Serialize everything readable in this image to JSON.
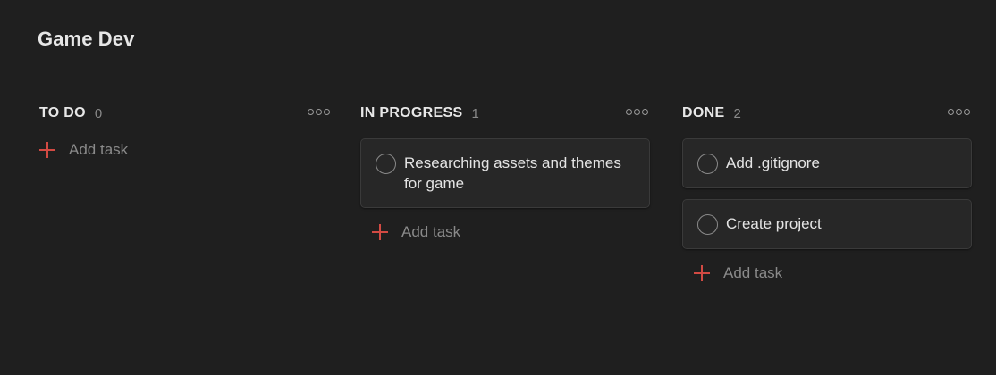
{
  "board": {
    "title": "Game Dev"
  },
  "columns": {
    "todo": {
      "name": "TO DO",
      "count": "0",
      "add_label": "Add task"
    },
    "in_progress": {
      "name": "IN PROGRESS",
      "count": "1",
      "add_label": "Add task",
      "tasks": [
        {
          "title": "Researching assets and themes for game"
        }
      ]
    },
    "done": {
      "name": "DONE",
      "count": "2",
      "add_label": "Add task",
      "tasks": [
        {
          "title": "Add .gitignore"
        },
        {
          "title": "Create project"
        }
      ]
    }
  },
  "icons": {
    "column_menu": "more-horizontal-icon",
    "add": "plus-icon",
    "task_check": "circle-check-icon"
  },
  "colors": {
    "background": "#1f1f1f",
    "card": "#272727",
    "accent": "#d24a43",
    "muted_text": "#8a8a8a"
  }
}
